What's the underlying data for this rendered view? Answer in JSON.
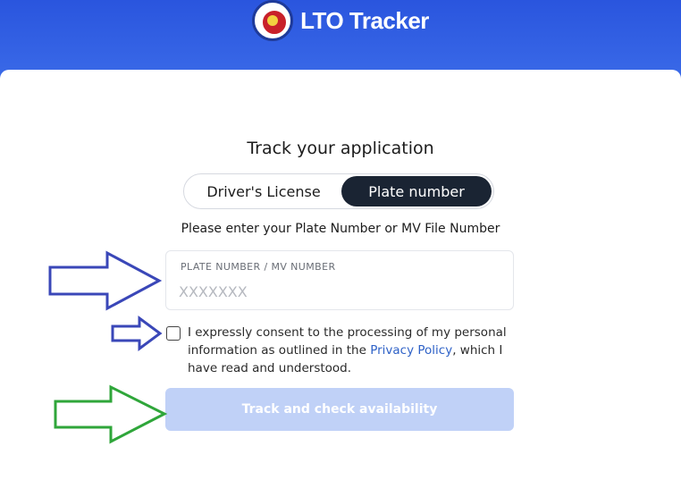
{
  "brand": {
    "title": "LTO Tracker"
  },
  "form": {
    "heading": "Track your application",
    "tabs": [
      {
        "label": "Driver's License",
        "active": false
      },
      {
        "label": "Plate number",
        "active": true
      }
    ],
    "instruction": "Please enter your Plate Number or MV File Number",
    "plate_field": {
      "label": "PLATE NUMBER / MV NUMBER",
      "placeholder": "XXXXXXX",
      "value": ""
    },
    "consent": {
      "checked": false,
      "text_before": "I expressly consent to the processing of my personal information as outlined in the ",
      "link_text": "Privacy Policy",
      "text_after": ", which I have read and understood."
    },
    "submit_label": "Track and check availability"
  },
  "annotations": [
    {
      "icon": "arrow-right-icon",
      "color": "#3a47b8"
    },
    {
      "icon": "arrow-right-icon",
      "color": "#3a47b8"
    },
    {
      "icon": "arrow-right-icon",
      "color": "#2fa63a"
    }
  ]
}
